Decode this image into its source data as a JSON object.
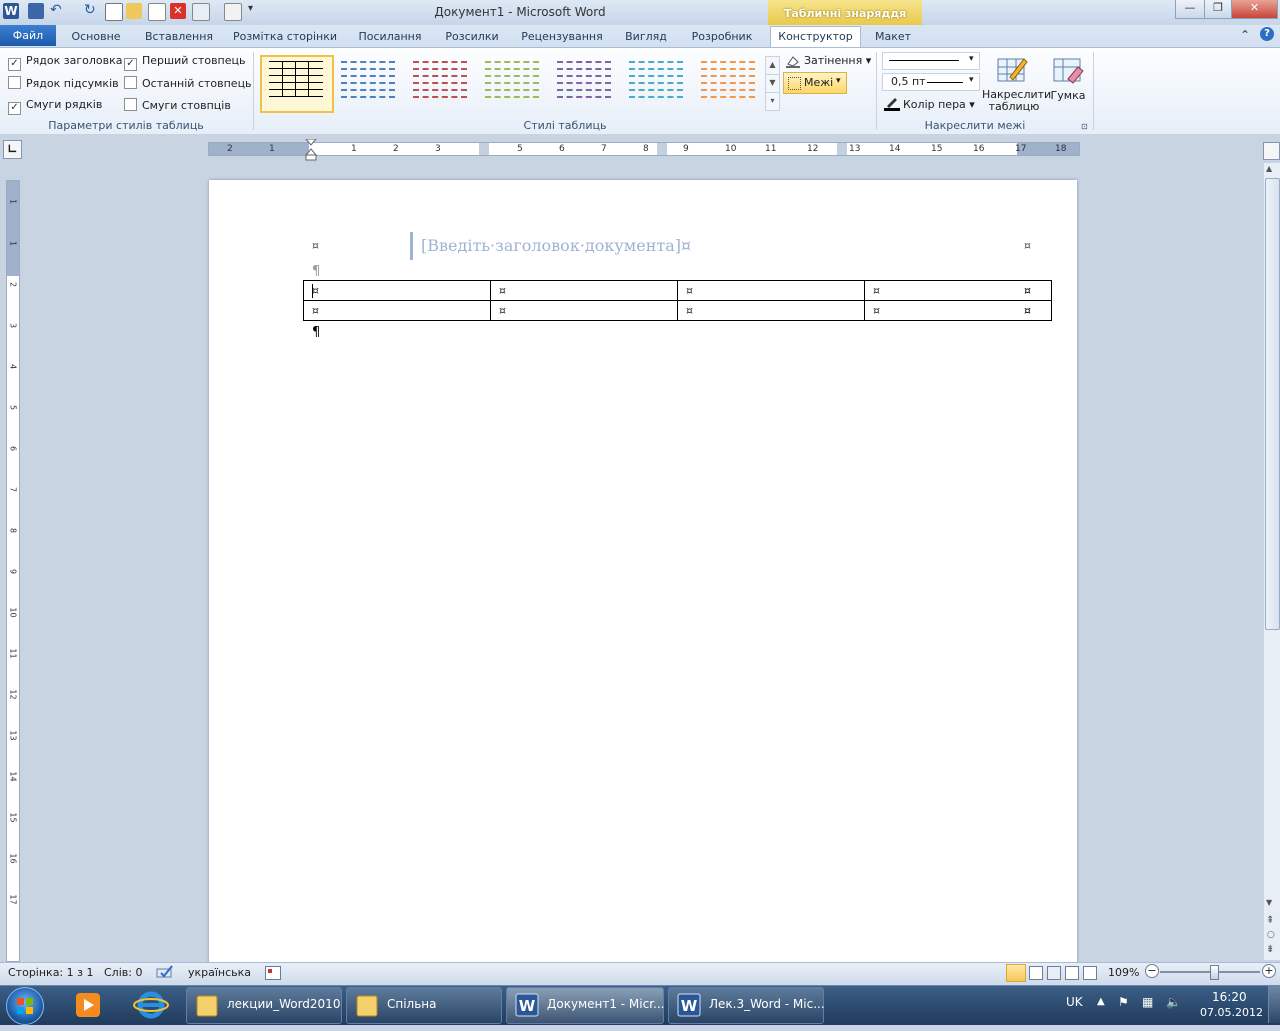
{
  "window": {
    "title": "Документ1 - Microsoft Word",
    "context_tab_group": "Табличні знаряддя",
    "minimize": "—",
    "restore": "❐",
    "close": "✕"
  },
  "tabs": {
    "file": "Файл",
    "items": [
      "Основне",
      "Вставлення",
      "Розмітка сторінки",
      "Посилання",
      "Розсилки",
      "Рецензування",
      "Вигляд",
      "Розробник"
    ],
    "active": "Конструктор",
    "layout": "Макет"
  },
  "ribbon": {
    "style_options": {
      "label": "Параметри стилів таблиць",
      "header_row": "Рядок заголовка",
      "total_row": "Рядок підсумків",
      "banded_rows": "Смуги рядків",
      "first_column": "Перший стовпець",
      "last_column": "Останній стовпець",
      "banded_columns": "Смуги стовпців",
      "checked": {
        "header_row": true,
        "total_row": false,
        "banded_rows": true,
        "first_column": true,
        "last_column": false,
        "banded_columns": false
      }
    },
    "table_styles": {
      "label": "Стилі таблиць",
      "colors": [
        "#000000",
        "#4f81bd",
        "#c0504d",
        "#9bbb59",
        "#8064a2",
        "#4bacc6",
        "#f79646"
      ],
      "shading": "Затінення",
      "borders": "Межі"
    },
    "draw_borders": {
      "label": "Накреслити межі",
      "weight": "0,5 пт",
      "pen_color": "Колір пера",
      "draw_table": "Накреслити таблицю",
      "eraser": "Гумка"
    }
  },
  "ruler": {
    "numbers": [
      "2",
      "1",
      "1",
      "2",
      "3",
      "5",
      "6",
      "7",
      "8",
      "9",
      "10",
      "11",
      "12",
      "13",
      "14",
      "15",
      "16",
      "17",
      "18"
    ],
    "vertical_numbers": [
      "1",
      "1",
      "2",
      "3",
      "4",
      "5",
      "6",
      "7",
      "8",
      "9",
      "10",
      "11",
      "12",
      "13",
      "14",
      "15",
      "16",
      "17"
    ]
  },
  "document": {
    "header_placeholder": "[Введіть·заголовок·документа]¤",
    "cell_mark": "¤",
    "paragraph_mark": "¶",
    "table": {
      "rows": 2,
      "cols": 4
    }
  },
  "status": {
    "page": "Сторінка: 1 з 1",
    "words": "Слів: 0",
    "language": "українська",
    "zoom": "109%",
    "zoom_fraction": 0.52
  },
  "taskbar": {
    "items": [
      {
        "label": "лекции_Word2010",
        "type": "folder"
      },
      {
        "label": "Спільна",
        "type": "folder"
      },
      {
        "label": "Документ1 - Micr...",
        "type": "word",
        "active": true
      },
      {
        "label": "Лек.3_Word - Mic...",
        "type": "word",
        "active": false
      }
    ],
    "lang": "UK",
    "time": "16:20",
    "date": "07.05.2012"
  }
}
